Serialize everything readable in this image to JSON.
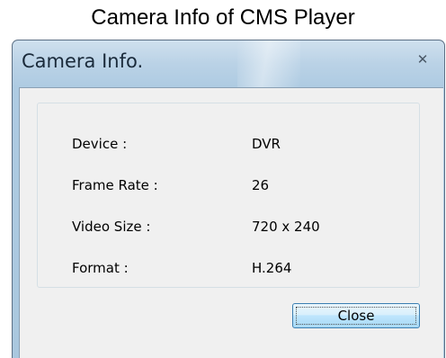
{
  "caption": "Camera Info of CMS Player",
  "window": {
    "title": "Camera Info.",
    "close_glyph": "✕"
  },
  "info": {
    "rows": [
      {
        "label": "Device :",
        "value": "DVR"
      },
      {
        "label": "Frame Rate :",
        "value": "26"
      },
      {
        "label": "Video Size :",
        "value": "720 x 240"
      },
      {
        "label": "Format :",
        "value": "H.264"
      }
    ]
  },
  "buttons": {
    "close_label": "Close"
  }
}
